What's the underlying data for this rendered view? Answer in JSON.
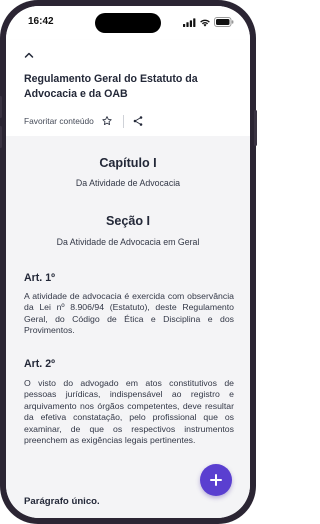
{
  "status_bar": {
    "time": "16:42"
  },
  "header": {
    "title": "Regulamento Geral do Estatuto da Advocacia e da OAB",
    "favorite_label": "Favoritar conteúdo"
  },
  "content": {
    "chapter_title": "Capítulo I",
    "chapter_subtitle": "Da Atividade de Advocacia",
    "section_title": "Seção I",
    "section_subtitle": "Da Atividade de Advocacia em Geral",
    "articles": [
      {
        "title": "Art. 1º",
        "text": "A atividade de advocacia é exercida com observância da Lei nº 8.906/94 (Estatuto), deste Regulamento Geral, do Código de Ética e Disciplina e dos Provimentos."
      },
      {
        "title": "Art. 2º",
        "text": "O visto do advogado em atos constitutivos de pessoas jurídicas, indispensável ao registro e arquivamento nos órgãos competentes, deve resultar da efetiva constatação, pelo profissional que os examinar, de que os respectivos instrumentos preenchem as exigências legais pertinentes."
      }
    ],
    "next_heading": "Parágrafo único."
  },
  "icons": {
    "back": "chevron-up-icon",
    "favorite": "star-outline-icon",
    "share": "share-icon",
    "fab": "plus-icon"
  },
  "colors": {
    "accent": "#5a3fd0",
    "title_text": "#232838",
    "body_text": "#333847",
    "background": "#f4f4f6"
  }
}
